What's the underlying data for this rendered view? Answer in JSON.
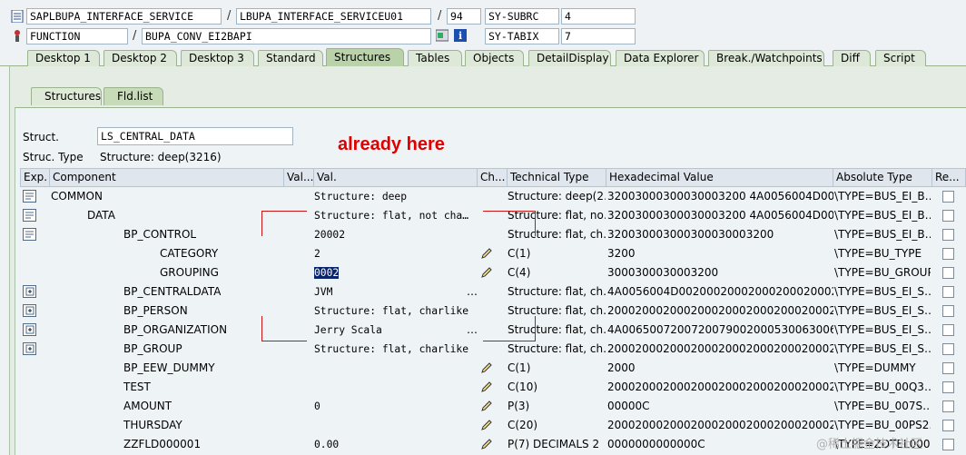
{
  "header": {
    "program": "SAPLBUPA_INTERFACE_SERVICE",
    "include": "LBUPA_INTERFACE_SERVICEU01",
    "line": "94",
    "var1_name": "SY-SUBRC",
    "var1_value": "4",
    "event_type": "FUNCTION",
    "event_name": "BUPA_CONV_EI2BAPI",
    "var2_name": "SY-TABIX",
    "var2_value": "7",
    "separator": "/"
  },
  "tabs": [
    "Desktop 1",
    "Desktop 2",
    "Desktop 3",
    "Standard",
    "Structures",
    "Tables",
    "Objects",
    "DetailDisplay",
    "Data Explorer",
    "Break./Watchpoints",
    "Diff",
    "Script"
  ],
  "active_tab": "Structures",
  "subtabs": [
    "Structures",
    "Fld.list"
  ],
  "active_subtab": "Fld.list",
  "struct": {
    "label": "Struct.",
    "value": "LS_CENTRAL_DATA",
    "type_label": "Struc. Type",
    "type_value": "Structure: deep(3216)"
  },
  "annotation": "already here",
  "columns": [
    "Exp.",
    "Component",
    "Val...",
    "Val.",
    "Ch...",
    "Technical Type",
    "Hexadecimal Value",
    "Absolute Type",
    "Re..."
  ],
  "rows": [
    {
      "exp": "open",
      "component": "COMMON",
      "level": 0,
      "val": "Structure: deep",
      "edit": false,
      "ttype": "Structure: deep(2…",
      "hex": "32003000300030003200 4A0056004D0020…",
      "atype": "\\TYPE=BUS_EI_B…"
    },
    {
      "exp": "open",
      "component": "DATA",
      "level": 1,
      "val": "Structure: flat, not cha…",
      "edit": false,
      "ttype": "Structure: flat, no…",
      "hex": "32003000300030003200 4A0056004D0020…",
      "atype": "\\TYPE=BUS_EI_B…"
    },
    {
      "exp": "open",
      "component": "BP_CONTROL",
      "level": 2,
      "val": "20002",
      "edit": false,
      "ttype": "Structure: flat, ch…",
      "hex": "320030003000300030003200",
      "atype": "\\TYPE=BUS_EI_B…"
    },
    {
      "exp": "none",
      "component": "CATEGORY",
      "level": 3,
      "val": "2",
      "edit": true,
      "ttype": "C(1)",
      "hex": "3200",
      "atype": "\\TYPE=BU_TYPE"
    },
    {
      "exp": "none",
      "component": "GROUPING",
      "level": 3,
      "val": "0002",
      "edit": true,
      "ttype": "C(4)",
      "hex": "3000300030003200",
      "atype": "\\TYPE=BU_GROUP"
    },
    {
      "exp": "closed",
      "component": "BP_CENTRALDATA",
      "level": 2,
      "val": "JVM",
      "edit": false,
      "ttype": "Structure: flat, ch…",
      "hex": "4A0056004D002000200020002000200020…",
      "atype": "\\TYPE=BUS_EI_S…"
    },
    {
      "exp": "closed",
      "component": "BP_PERSON",
      "level": 2,
      "val": "Structure: flat, charlike",
      "edit": false,
      "ttype": "Structure: flat, ch…",
      "hex": "20002000200020002000200020002000200…",
      "atype": "\\TYPE=BUS_EI_S…"
    },
    {
      "exp": "closed",
      "component": "BP_ORGANIZATION",
      "level": 2,
      "val": "Jerry Scala",
      "edit": false,
      "ttype": "Structure: flat, ch…",
      "hex": "4A0065007200720079002000530063006 1…",
      "atype": "\\TYPE=BUS_EI_S…"
    },
    {
      "exp": "closed",
      "component": "BP_GROUP",
      "level": 2,
      "val": "Structure: flat, charlike",
      "edit": false,
      "ttype": "Structure: flat, ch…",
      "hex": "20002000200020002000200020002000200…",
      "atype": "\\TYPE=BUS_EI_S…"
    },
    {
      "exp": "none",
      "component": "BP_EEW_DUMMY",
      "level": 2,
      "val": "",
      "edit": true,
      "ttype": "C(1)",
      "hex": "2000",
      "atype": "\\TYPE=DUMMY"
    },
    {
      "exp": "none",
      "component": "TEST",
      "level": 2,
      "val": "",
      "edit": true,
      "ttype": "C(10)",
      "hex": "20002000200020002000200020002000200…",
      "atype": "\\TYPE=BU_00Q3…"
    },
    {
      "exp": "none",
      "component": "AMOUNT",
      "level": 2,
      "val": "0",
      "edit": true,
      "ttype": "P(3)",
      "hex": "00000C",
      "atype": "\\TYPE=BU_007S…"
    },
    {
      "exp": "none",
      "component": "THURSDAY",
      "level": 2,
      "val": "",
      "edit": true,
      "ttype": "C(20)",
      "hex": "20002000200020002000200020002000200…",
      "atype": "\\TYPE=BU_00PS2…"
    },
    {
      "exp": "none",
      "component": "ZZFLD000001",
      "level": 2,
      "val": "0.00",
      "edit": true,
      "ttype": "P(7) DECIMALS 2",
      "hex": "0000000000000C",
      "atype": "\\TYPE=ZDTEL000…"
    }
  ],
  "ellipsis_rows": [
    5,
    7
  ],
  "highlight_row": 4,
  "watermark": "@稀土掘金技术社区",
  "colors": {
    "annotation": "#e00000",
    "tab_active": "#b9d2a9",
    "highlight": "#0a246a"
  }
}
